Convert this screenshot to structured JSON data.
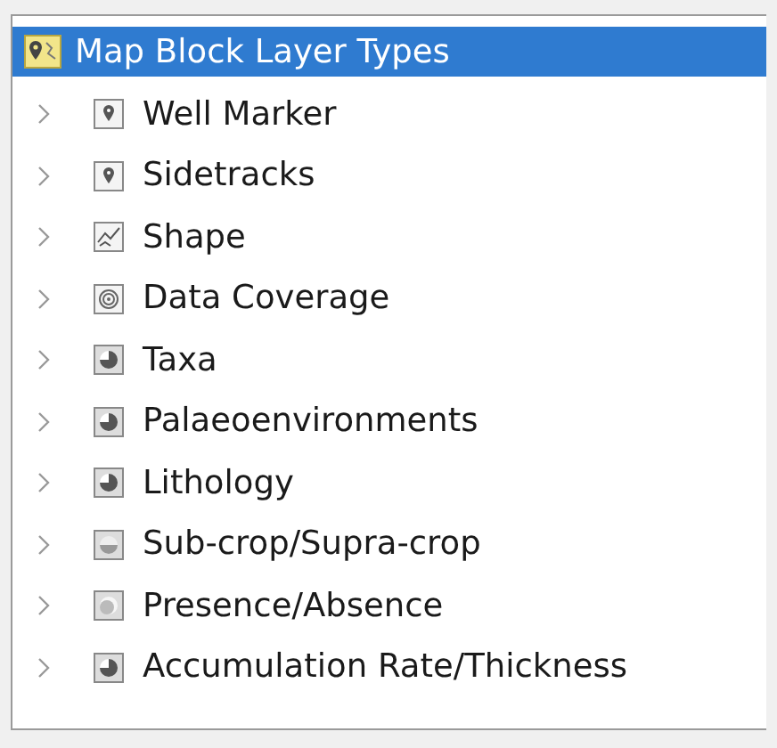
{
  "tree": {
    "root": {
      "label": "Map Block Layer Types",
      "selected": true
    },
    "items": [
      {
        "label": "Well Marker",
        "kind": "pin",
        "expanded": false,
        "selected": false
      },
      {
        "label": "Sidetracks",
        "kind": "pin",
        "expanded": false,
        "selected": false
      },
      {
        "label": "Shape",
        "kind": "shape",
        "expanded": false,
        "selected": false
      },
      {
        "label": "Data Coverage",
        "kind": "target",
        "expanded": false,
        "selected": false
      },
      {
        "label": "Taxa",
        "kind": "pie",
        "expanded": false,
        "selected": false
      },
      {
        "label": "Palaeoenvironments",
        "kind": "pie",
        "expanded": false,
        "selected": false
      },
      {
        "label": "Lithology",
        "kind": "pie",
        "expanded": false,
        "selected": false
      },
      {
        "label": "Sub-crop/Supra-crop",
        "kind": "halfdot",
        "expanded": false,
        "selected": false
      },
      {
        "label": "Presence/Absence",
        "kind": "dot",
        "expanded": false,
        "selected": false
      },
      {
        "label": "Accumulation Rate/Thickness",
        "kind": "pie",
        "expanded": false,
        "selected": false
      }
    ]
  }
}
